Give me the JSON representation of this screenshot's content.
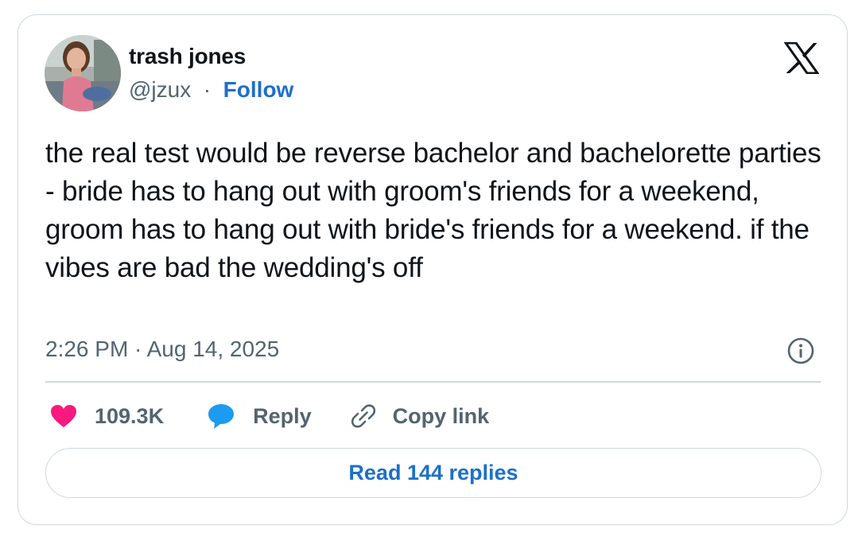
{
  "author": {
    "display_name": "trash jones",
    "handle": "@jzux",
    "separator": "·",
    "follow_label": "Follow"
  },
  "tweet": {
    "text": "the real test would be reverse bachelor and bachelorette parties - bride has to hang out with groom's friends for a weekend, groom has to hang out with bride's friends for a weekend. if the vibes are bad the wedding's off",
    "timestamp": "2:26 PM · Aug 14, 2025"
  },
  "actions": {
    "like_count": "109.3K",
    "reply_label": "Reply",
    "copy_link_label": "Copy link"
  },
  "read_replies_label": "Read 144 replies",
  "icons": {
    "brand": "x-logo-icon",
    "info": "info-icon",
    "like": "heart-icon",
    "reply": "speech-bubble-icon",
    "copy": "link-icon"
  },
  "colors": {
    "heart": "#f91880",
    "reply_bubble": "#1d9bf0",
    "follow_link": "#1d6fc9",
    "muted_text": "#536471",
    "border": "#cfd9de"
  }
}
